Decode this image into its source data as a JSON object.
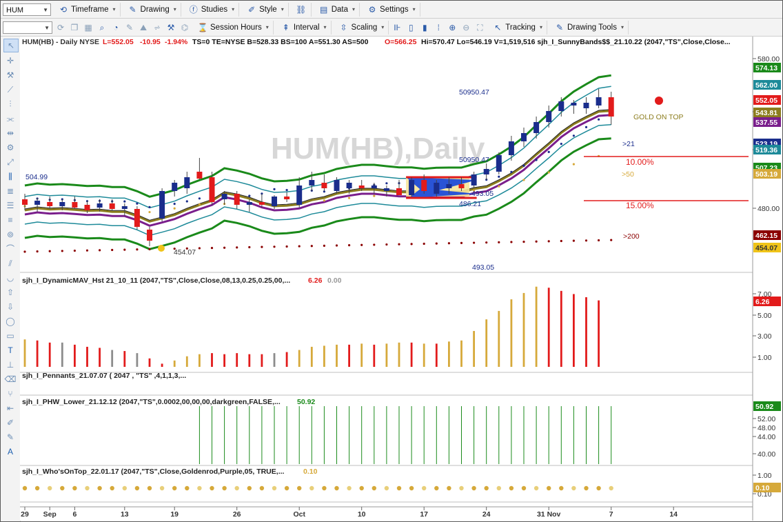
{
  "toolbar1": {
    "symbol": "HUM",
    "menus": [
      "Timeframe",
      "Drawing",
      "Studies",
      "Style",
      "Data",
      "Settings"
    ]
  },
  "toolbar2": {
    "menus": [
      "Session Hours",
      "Interval",
      "Scaling",
      "Tracking",
      "Drawing Tools"
    ]
  },
  "header": {
    "symbol": "HUM(HB) - Daily",
    "exchange": "NYSE",
    "last": "L=552.05",
    "change": "-10.95",
    "pct": "-1.94%",
    "rest": "TS=0  TE=NYSE  B=528.33  BS=100  A=551.30  AS=500",
    "open": "O=566.25",
    "tail": "Hi=570.47  Lo=546.19  V=1,519,516  sjh_I_SunnyBands$$_21.10.22 (2047,\"TS\",Close,Close..."
  },
  "watermark": "HUM(HB),Daily",
  "colors": {
    "up": "#1a2d8c",
    "down": "#e21b1b",
    "gold": "#d6a93a",
    "green": "#1a8a1a",
    "purple": "#7a1e8c",
    "olive": "#8c7d1e",
    "teal": "#1d8a99",
    "darkred": "#8b0000"
  },
  "panels": {
    "price": {
      "annotations": {
        "p1": "50950.47",
        "p2": "50950.47",
        "p3": "504.99",
        "p4": "493.05",
        "p5": "486.21",
        "p6": "454.07",
        "p7": "493.05",
        "gold_on_top": "GOLD ON TOP",
        "pct10": "10.00%",
        "pct15": "15.00%",
        "ma21": ">21",
        "ma50": ">50",
        "ma200": ">200"
      },
      "axis_ticks": [
        "580.00",
        "540.00",
        "520.00",
        "480.00"
      ],
      "price_tags": [
        {
          "label": "574.13",
          "color": "#1a8a1a"
        },
        {
          "label": "562.00",
          "color": "#1d8a99"
        },
        {
          "label": "552.05",
          "color": "#e21b1b"
        },
        {
          "label": "543.81",
          "color": "#8c7d1e"
        },
        {
          "label": "537.55",
          "color": "#7a1e8c"
        },
        {
          "label": "523.19",
          "color": "#1a2d8c"
        },
        {
          "label": "519.36",
          "color": "#1d8a99"
        },
        {
          "label": "507.23",
          "color": "#1a8a1a"
        },
        {
          "label": "503.19",
          "color": "#d6a93a"
        },
        {
          "label": "462.15",
          "color": "#8b0000"
        },
        {
          "label": "454.07",
          "color": "#f0c419"
        }
      ]
    },
    "mav": {
      "title": "sjh_I_DynamicMAV_Hst 21_10_11 (2047,\"TS\",Close,Close,08,13,0.25,0.25,00,...",
      "v1": "6.26",
      "v2": "0.00",
      "axis_ticks": [
        "7.00",
        "5.00",
        "3.00",
        "1.00"
      ],
      "tag": "6.26"
    },
    "pennants": {
      "title": "sjh_I_Pennants_21.07.07 ( 2047 , \"TS\" ,4,1,1,3,..."
    },
    "phw": {
      "title": "sjh_I_PHW_Lower_21.12.12 (2047,\"TS\",0.0002,00,00,00,darkgreen,FALSE,...",
      "v1": "50.92",
      "axis_ticks": [
        "52.00",
        "48.00",
        "44.00",
        "40.00"
      ],
      "tag": "50.92"
    },
    "who": {
      "title": "sjh_I_Who'sOnTop_22.01.17 (2047,\"TS\",Close,Goldenrod,Purple,05, TRUE,...",
      "v1": "0.10",
      "axis_ticks": [
        "1.00",
        "0.10"
      ],
      "tag": "0.10"
    }
  },
  "x_axis": {
    "labels": [
      {
        "label": "29",
        "index": 0
      },
      {
        "label": "Sep",
        "index": 2
      },
      {
        "label": "6",
        "index": 4
      },
      {
        "label": "13",
        "index": 8
      },
      {
        "label": "19",
        "index": 12
      },
      {
        "label": "26",
        "index": 17
      },
      {
        "label": "Oct",
        "index": 22
      },
      {
        "label": "10",
        "index": 27
      },
      {
        "label": "17",
        "index": 32
      },
      {
        "label": "24",
        "index": 37
      },
      {
        "label": "31 Nov",
        "index": 42
      },
      {
        "label": "7",
        "index": 47
      },
      {
        "label": "14",
        "index": 52
      }
    ]
  },
  "chart_data": {
    "type": "candlestick",
    "ylim": [
      440,
      590
    ],
    "candles": [
      {
        "o": 492,
        "h": 496,
        "l": 484,
        "c": 488
      },
      {
        "o": 488,
        "h": 493,
        "l": 483,
        "c": 491
      },
      {
        "o": 490,
        "h": 494,
        "l": 485,
        "c": 487
      },
      {
        "o": 487,
        "h": 492,
        "l": 484,
        "c": 490
      },
      {
        "o": 490,
        "h": 494,
        "l": 485,
        "c": 486
      },
      {
        "o": 488,
        "h": 491,
        "l": 482,
        "c": 484
      },
      {
        "o": 486,
        "h": 492,
        "l": 483,
        "c": 489
      },
      {
        "o": 489,
        "h": 492,
        "l": 484,
        "c": 485
      },
      {
        "o": 485,
        "h": 489,
        "l": 480,
        "c": 487
      },
      {
        "o": 485,
        "h": 487,
        "l": 470,
        "c": 472
      },
      {
        "o": 470,
        "h": 472,
        "l": 458,
        "c": 462
      },
      {
        "o": 478,
        "h": 500,
        "l": 476,
        "c": 498
      },
      {
        "o": 498,
        "h": 506,
        "l": 494,
        "c": 504
      },
      {
        "o": 500,
        "h": 512,
        "l": 496,
        "c": 508
      },
      {
        "o": 512,
        "h": 522,
        "l": 506,
        "c": 507
      },
      {
        "o": 508,
        "h": 512,
        "l": 488,
        "c": 490
      },
      {
        "o": 492,
        "h": 498,
        "l": 488,
        "c": 496
      },
      {
        "o": 496,
        "h": 498,
        "l": 485,
        "c": 488
      },
      {
        "o": 488,
        "h": 492,
        "l": 483,
        "c": 490
      },
      {
        "o": 490,
        "h": 496,
        "l": 486,
        "c": 488
      },
      {
        "o": 487,
        "h": 495,
        "l": 485,
        "c": 494
      },
      {
        "o": 494,
        "h": 497,
        "l": 490,
        "c": 492
      },
      {
        "o": 488,
        "h": 508,
        "l": 486,
        "c": 502
      },
      {
        "o": 502,
        "h": 512,
        "l": 498,
        "c": 506
      },
      {
        "o": 504,
        "h": 510,
        "l": 498,
        "c": 500
      },
      {
        "o": 498,
        "h": 508,
        "l": 496,
        "c": 506
      },
      {
        "o": 500,
        "h": 506,
        "l": 496,
        "c": 504
      },
      {
        "o": 502,
        "h": 506,
        "l": 498,
        "c": 500
      },
      {
        "o": 500,
        "h": 504,
        "l": 496,
        "c": 502
      },
      {
        "o": 498,
        "h": 502,
        "l": 494,
        "c": 500
      },
      {
        "o": 500,
        "h": 506,
        "l": 496,
        "c": 495
      },
      {
        "o": 495,
        "h": 508,
        "l": 494,
        "c": 506
      },
      {
        "o": 506,
        "h": 510,
        "l": 496,
        "c": 498
      },
      {
        "o": 496,
        "h": 506,
        "l": 494,
        "c": 504
      },
      {
        "o": 500,
        "h": 508,
        "l": 496,
        "c": 503
      },
      {
        "o": 503,
        "h": 508,
        "l": 498,
        "c": 500
      },
      {
        "o": 502,
        "h": 512,
        "l": 500,
        "c": 510
      },
      {
        "o": 510,
        "h": 518,
        "l": 506,
        "c": 514
      },
      {
        "o": 512,
        "h": 526,
        "l": 510,
        "c": 524
      },
      {
        "o": 524,
        "h": 538,
        "l": 520,
        "c": 534
      },
      {
        "o": 534,
        "h": 544,
        "l": 530,
        "c": 540
      },
      {
        "o": 540,
        "h": 552,
        "l": 536,
        "c": 548
      },
      {
        "o": 548,
        "h": 560,
        "l": 544,
        "c": 556
      },
      {
        "o": 556,
        "h": 566,
        "l": 552,
        "c": 563
      },
      {
        "o": 560,
        "h": 564,
        "l": 554,
        "c": 562
      },
      {
        "o": 558,
        "h": 566,
        "l": 554,
        "c": 562
      },
      {
        "o": 560,
        "h": 572,
        "l": 558,
        "c": 566
      },
      {
        "o": 566,
        "h": 570,
        "l": 546,
        "c": 552
      }
    ],
    "mav_bars": [
      {
        "v": 2.6,
        "c": "gold"
      },
      {
        "v": 2.5,
        "c": "red"
      },
      {
        "v": 2.3,
        "c": "red"
      },
      {
        "v": 2.3,
        "c": "grey"
      },
      {
        "v": 2.1,
        "c": "red"
      },
      {
        "v": 1.9,
        "c": "red"
      },
      {
        "v": 1.8,
        "c": "red"
      },
      {
        "v": 1.6,
        "c": "grey"
      },
      {
        "v": 1.5,
        "c": "red"
      },
      {
        "v": 1.3,
        "c": "grey"
      },
      {
        "v": 0.8,
        "c": "red"
      },
      {
        "v": 0.3,
        "c": "red"
      },
      {
        "v": 0.6,
        "c": "gold"
      },
      {
        "v": 1.0,
        "c": "gold"
      },
      {
        "v": 1.2,
        "c": "gold"
      },
      {
        "v": 1.3,
        "c": "red"
      },
      {
        "v": 1.2,
        "c": "red"
      },
      {
        "v": 1.3,
        "c": "red"
      },
      {
        "v": 1.2,
        "c": "red"
      },
      {
        "v": 1.2,
        "c": "red"
      },
      {
        "v": 1.3,
        "c": "grey"
      },
      {
        "v": 1.4,
        "c": "red"
      },
      {
        "v": 1.6,
        "c": "gold"
      },
      {
        "v": 1.9,
        "c": "gold"
      },
      {
        "v": 2.0,
        "c": "gold"
      },
      {
        "v": 2.1,
        "c": "gold"
      },
      {
        "v": 2.1,
        "c": "red"
      },
      {
        "v": 2.2,
        "c": "gold"
      },
      {
        "v": 2.1,
        "c": "red"
      },
      {
        "v": 2.2,
        "c": "gold"
      },
      {
        "v": 2.3,
        "c": "gold"
      },
      {
        "v": 2.3,
        "c": "red"
      },
      {
        "v": 2.2,
        "c": "gold"
      },
      {
        "v": 2.2,
        "c": "red"
      },
      {
        "v": 2.4,
        "c": "gold"
      },
      {
        "v": 2.5,
        "c": "gold"
      },
      {
        "v": 3.4,
        "c": "gold"
      },
      {
        "v": 4.5,
        "c": "gold"
      },
      {
        "v": 5.3,
        "c": "gold"
      },
      {
        "v": 6.4,
        "c": "gold"
      },
      {
        "v": 7.0,
        "c": "gold"
      },
      {
        "v": 7.6,
        "c": "gold"
      },
      {
        "v": 7.5,
        "c": "red"
      },
      {
        "v": 7.2,
        "c": "red"
      },
      {
        "v": 6.9,
        "c": "red"
      },
      {
        "v": 6.6,
        "c": "red"
      },
      {
        "v": 6.3,
        "c": "red"
      }
    ],
    "phw_start_index": 14,
    "phw_value": 50.92
  }
}
